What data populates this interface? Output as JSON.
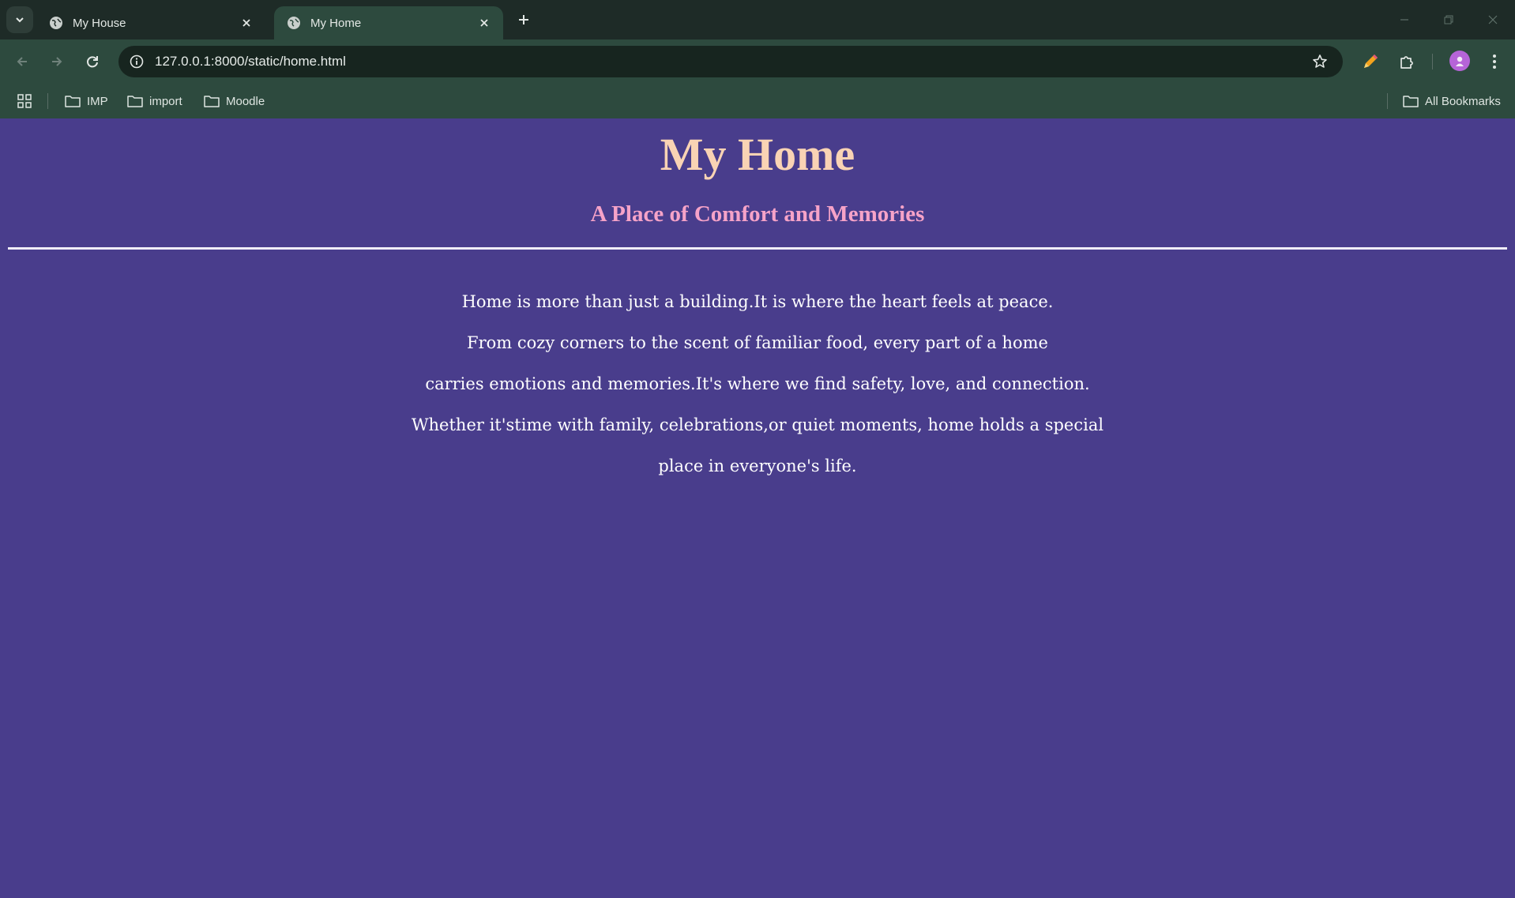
{
  "browser": {
    "tabs": [
      {
        "title": "My House",
        "active": false
      },
      {
        "title": "My Home",
        "active": true
      }
    ],
    "address_bar": {
      "url": "127.0.0.1:8000/static/home.html"
    },
    "bookmarks": [
      "IMP",
      "import",
      "Moodle"
    ],
    "all_bookmarks_label": "All Bookmarks",
    "icons": [
      "tab-search-icon",
      "globe-icon",
      "close-icon",
      "plus-icon",
      "minimize-icon",
      "restore-icon",
      "window-close-icon",
      "back-icon",
      "forward-icon",
      "reload-icon",
      "site-info-icon",
      "star-icon",
      "pencil-extension-icon",
      "puzzle-icon",
      "profile-avatar",
      "kebab-menu-icon",
      "apps-grid-icon",
      "folder-icon"
    ]
  },
  "page": {
    "title": "My Home",
    "subtitle": "A Place of Comfort and Memories",
    "paragraph_lines": [
      "Home is more than just a building.It is where the heart feels at peace.",
      "From cozy corners to the scent of familiar food, every part of a home",
      "carries emotions and memories.It's where we find safety, love, and connection.",
      "Whether it'stime with family, celebrations,or quiet moments, home holds a special",
      "place in everyone's life."
    ],
    "colors": {
      "background": "#493d8c",
      "title": "#f9d3b4",
      "subtitle": "#f6a3c8",
      "text": "#ffffff"
    }
  }
}
